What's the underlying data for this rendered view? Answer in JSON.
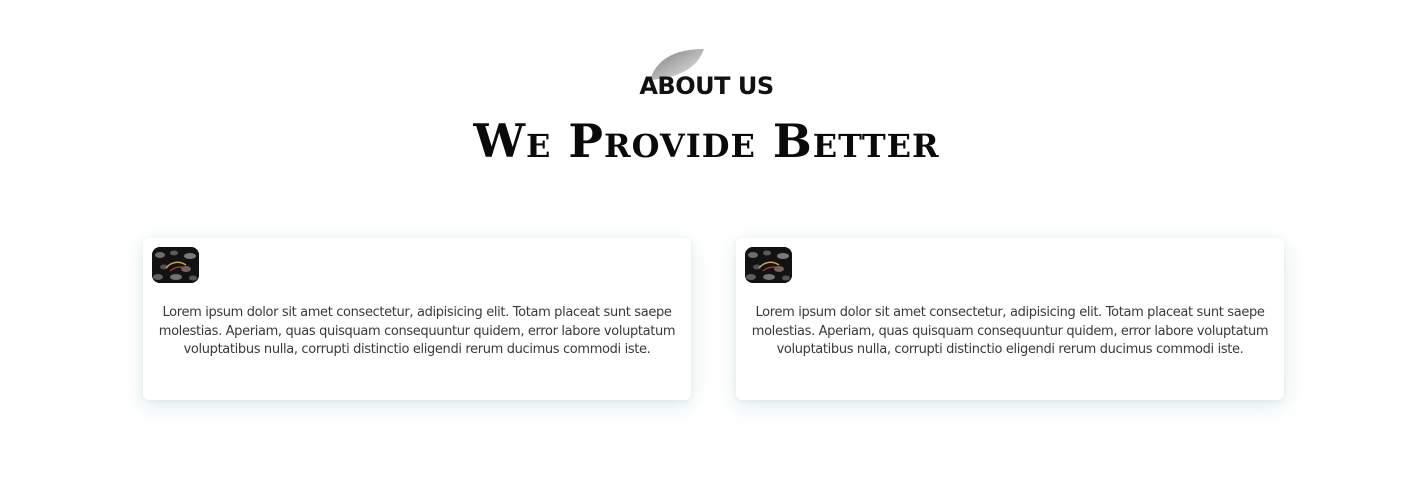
{
  "heading": {
    "eyebrow": "ABOUT US",
    "title": "We Provide Better"
  },
  "cards": [
    {
      "thumbnail_icon": "card-thumbnail-image",
      "text": "Lorem ipsum dolor sit amet consectetur, adipisicing elit. Totam placeat sunt saepe molestias. Aperiam, quas quisquam consequuntur quidem, error labore voluptatum voluptatibus nulla, corrupti distinctio eligendi rerum ducimus commodi iste."
    },
    {
      "thumbnail_icon": "card-thumbnail-image",
      "text": "Lorem ipsum dolor sit amet consectetur, adipisicing elit. Totam placeat sunt saepe molestias. Aperiam, quas quisquam consequuntur quidem, error labore voluptatum voluptatibus nulla, corrupti distinctio eligendi rerum ducimus commodi iste."
    }
  ],
  "colors": {
    "background": "#ffffff",
    "heading": "#111111",
    "body_text": "#3a3a3a",
    "leaf_gradient_start": "#8a8a8a",
    "leaf_gradient_end": "#e6e6e6"
  }
}
